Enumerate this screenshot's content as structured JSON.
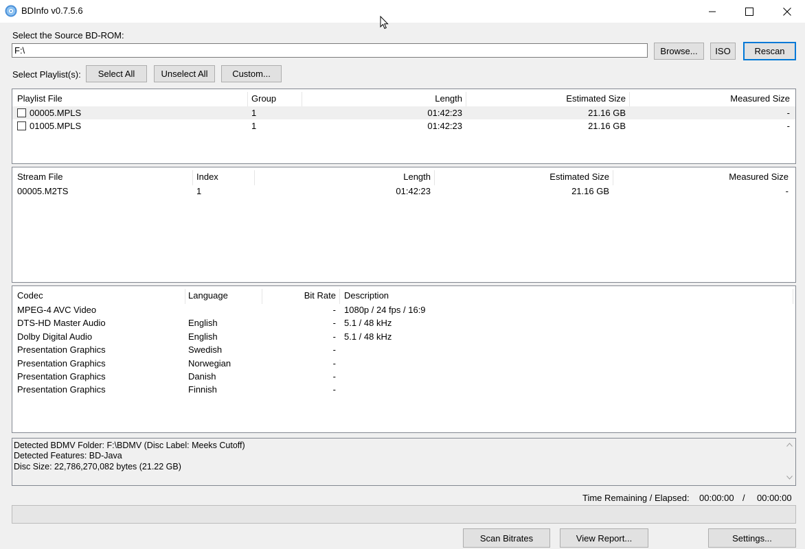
{
  "window": {
    "title": "BDInfo v0.7.5.6",
    "minimize_icon": "minimize-icon",
    "maximize_icon": "maximize-icon",
    "close_icon": "close-icon"
  },
  "source": {
    "label": "Select the Source BD-ROM:",
    "path": "F:\\",
    "browse_label": "Browse...",
    "iso_label": "ISO",
    "rescan_label": "Rescan"
  },
  "playlist_select": {
    "label": "Select Playlist(s):",
    "select_all_label": "Select All",
    "unselect_all_label": "Unselect All",
    "custom_label": "Custom..."
  },
  "playlists": {
    "headers": {
      "file": "Playlist File",
      "group": "Group",
      "length": "Length",
      "estimated": "Estimated Size",
      "measured": "Measured Size"
    },
    "rows": [
      {
        "file": "00005.MPLS",
        "group": "1",
        "length": "01:42:23",
        "estimated": "21.16 GB",
        "measured": "-",
        "checked": false
      },
      {
        "file": "01005.MPLS",
        "group": "1",
        "length": "01:42:23",
        "estimated": "21.16 GB",
        "measured": "-",
        "checked": false
      }
    ]
  },
  "streams": {
    "headers": {
      "file": "Stream File",
      "index": "Index",
      "length": "Length",
      "estimated": "Estimated Size",
      "measured": "Measured Size"
    },
    "rows": [
      {
        "file": "00005.M2TS",
        "index": "1",
        "length": "01:42:23",
        "estimated": "21.16 GB",
        "measured": "-"
      }
    ]
  },
  "codecs": {
    "headers": {
      "codec": "Codec",
      "language": "Language",
      "bitrate": "Bit Rate",
      "description": "Description"
    },
    "rows": [
      {
        "codec": "MPEG-4 AVC Video",
        "language": "",
        "bitrate": "-",
        "description": "1080p / 24 fps / 16:9"
      },
      {
        "codec": "DTS-HD Master Audio",
        "language": "English",
        "bitrate": "-",
        "description": "5.1 / 48 kHz"
      },
      {
        "codec": "Dolby Digital Audio",
        "language": "English",
        "bitrate": "-",
        "description": "5.1 / 48 kHz"
      },
      {
        "codec": "Presentation Graphics",
        "language": "Swedish",
        "bitrate": "-",
        "description": ""
      },
      {
        "codec": "Presentation Graphics",
        "language": "Norwegian",
        "bitrate": "-",
        "description": ""
      },
      {
        "codec": "Presentation Graphics",
        "language": "Danish",
        "bitrate": "-",
        "description": ""
      },
      {
        "codec": "Presentation Graphics",
        "language": "Finnish",
        "bitrate": "-",
        "description": ""
      }
    ]
  },
  "info": {
    "lines": [
      "Detected BDMV Folder: F:\\BDMV (Disc Label: Meeks Cutoff)",
      "Detected Features: BD-Java",
      "Disc Size: 22,786,270,082 bytes (21.22 GB)"
    ]
  },
  "status": {
    "label": "Time Remaining / Elapsed:",
    "remaining": "00:00:00",
    "separator": "/",
    "elapsed": "00:00:00",
    "progress": 0
  },
  "actions": {
    "scan_bitrates_label": "Scan Bitrates",
    "view_report_label": "View Report...",
    "settings_label": "Settings..."
  },
  "colors": {
    "accent": "#0078d7",
    "window_bg": "#f0f0f0",
    "selected_row": "#efefef"
  }
}
